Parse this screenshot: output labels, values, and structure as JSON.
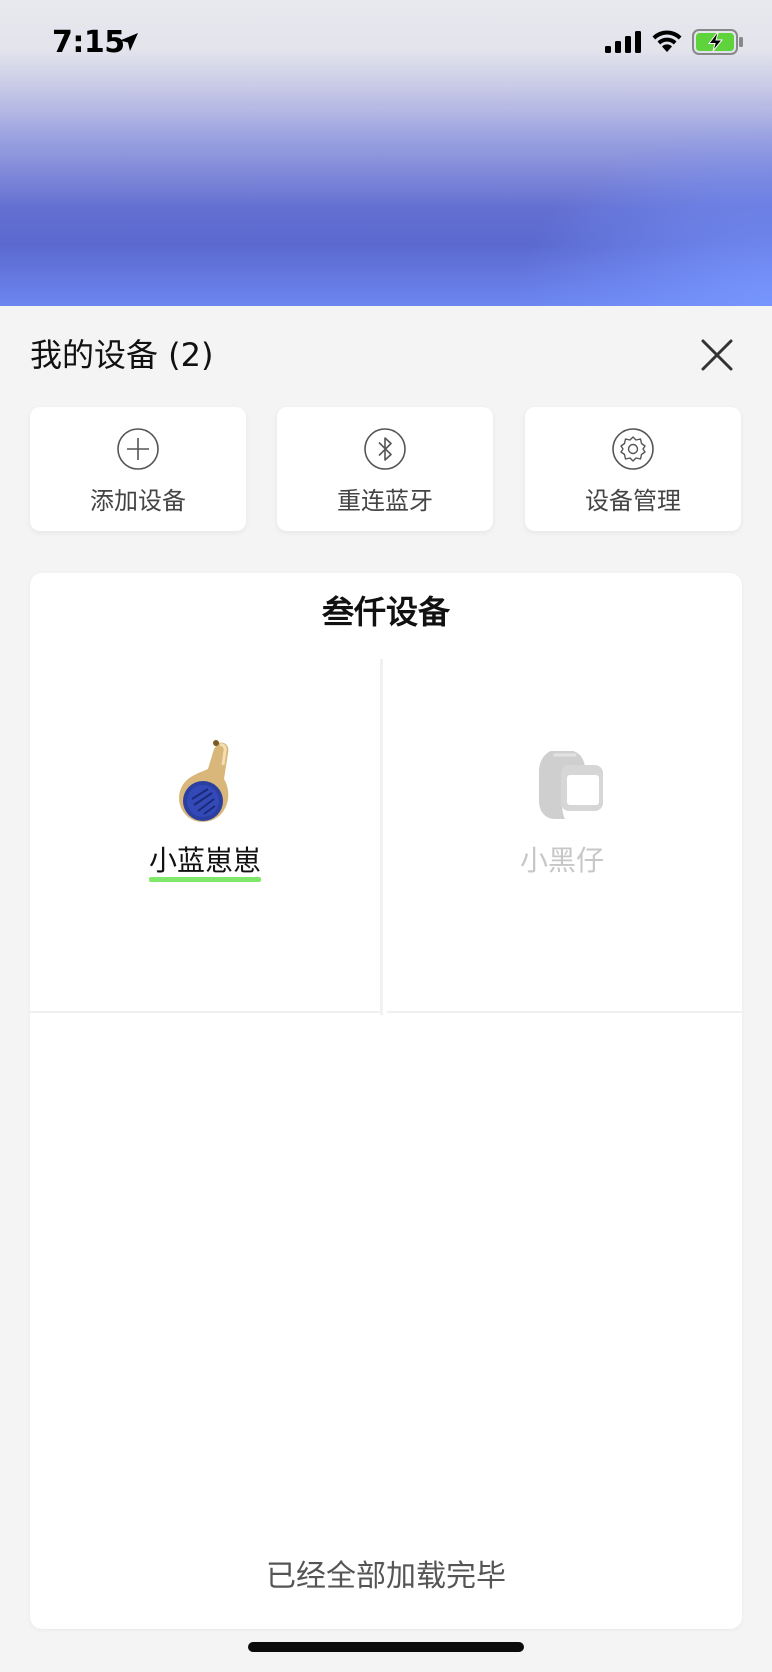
{
  "status_bar": {
    "time": "7:15",
    "icons": [
      "location-arrow-icon",
      "cellular-signal-icon",
      "wifi-icon",
      "battery-charging-icon"
    ],
    "battery_color": "#5fd33b"
  },
  "sheet": {
    "title": "我的设备 (2)",
    "close_icon": "close-icon"
  },
  "actions": [
    {
      "label": "添加设备",
      "icon": "plus-circle-icon"
    },
    {
      "label": "重连蓝牙",
      "icon": "bluetooth-icon"
    },
    {
      "label": "设备管理",
      "icon": "gear-icon"
    }
  ],
  "devices_panel": {
    "title": "叁仟设备",
    "devices": [
      {
        "name": "小蓝崽崽",
        "selected": true,
        "icon": "blue-pendant-device-icon"
      },
      {
        "name": "小黑仔",
        "selected": false,
        "icon": "camera-device-icon"
      }
    ],
    "footer": "已经全部加载完毕"
  },
  "colors": {
    "accent_underline": "#7fe86a",
    "hero_blue": "#5b69cf"
  }
}
